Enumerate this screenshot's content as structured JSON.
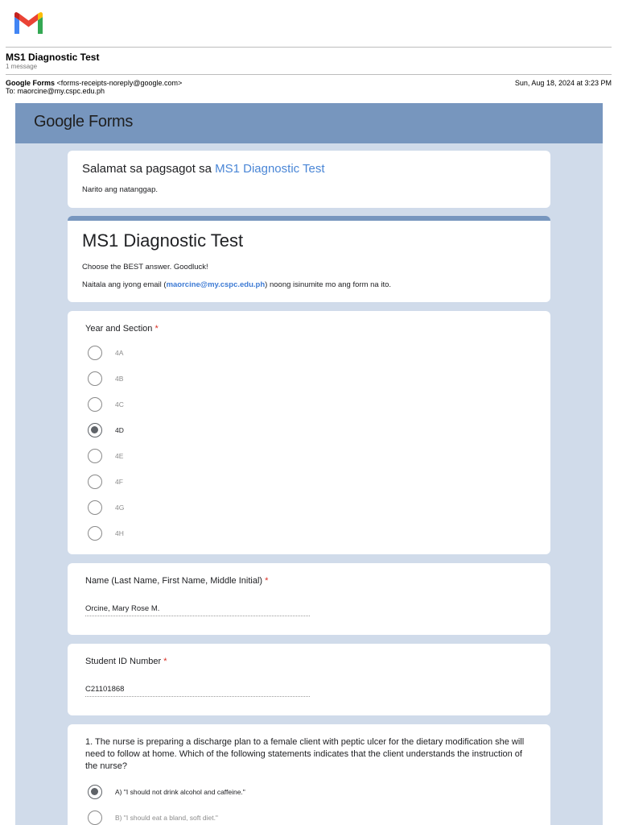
{
  "email": {
    "subject": "MS1 Diagnostic Test",
    "message_count": "1 message",
    "from_name": "Google Forms",
    "from_address": "<forms-receipts-noreply@google.com>",
    "to_line": "To: maorcine@my.cspc.edu.ph",
    "date": "Sun, Aug 18, 2024 at 3:23 PM",
    "logo_icon": "gmail-logo-icon"
  },
  "forms": {
    "logo_google": "Google",
    "logo_forms": " Forms",
    "header_color": "#7796be",
    "background_color": "#d0dbea",
    "thanks": {
      "prefix": "Salamat sa pagsagot sa ",
      "link_text": "MS1 Diagnostic Test",
      "subtitle": "Narito ang natanggap."
    },
    "title_card": {
      "title": "MS1 Diagnostic Test",
      "description": "Choose the BEST answer. Goodluck!",
      "email_prefix": "Naitala ang iyong email (",
      "email": "maorcine@my.cspc.edu.ph",
      "email_suffix": ") noong isinumite mo ang form na ito."
    },
    "year_section": {
      "label": "Year and Section ",
      "required_mark": "*",
      "options": [
        "4A",
        "4B",
        "4C",
        "4D",
        "4E",
        "4F",
        "4G",
        "4H"
      ],
      "selected": "4D"
    },
    "name_question": {
      "label": "Name (Last Name, First Name, Middle Initial) ",
      "required_mark": "*",
      "answer": "Orcine, Mary Rose M."
    },
    "student_id": {
      "label": "Student ID Number ",
      "required_mark": "*",
      "answer": "C21101868"
    },
    "question1": {
      "text": "1.  The nurse is preparing a discharge plan to a female client with peptic ulcer for the dietary modification she will need to follow at home. Which of the following statements indicates that the client understands the instruction of the nurse?",
      "options": [
        "A) \"I should not drink alcohol and caffeine.\"",
        "B) \"I should eat a bland, soft diet.\""
      ],
      "selected": "A) \"I should not drink alcohol and caffeine.\""
    }
  }
}
